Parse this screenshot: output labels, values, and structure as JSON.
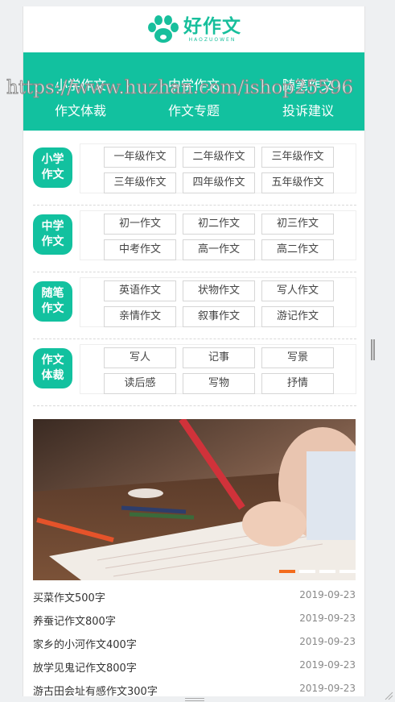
{
  "logo": {
    "title": "好作文",
    "subtitle": "HAOZUOWEN",
    "brand_color": "#17bf9c"
  },
  "nav": [
    "小学作文",
    "中学作文",
    "随笔作文",
    "作文体裁",
    "作文专题",
    "投诉建议"
  ],
  "watermark": "https://www.huzhan.com/ishop25596",
  "categories": [
    {
      "label": "小学作文",
      "items": [
        "一年级作文",
        "二年级作文",
        "三年级作文",
        "三年级作文",
        "四年级作文",
        "五年级作文"
      ]
    },
    {
      "label": "中学作文",
      "items": [
        "初一作文",
        "初二作文",
        "初三作文",
        "中考作文",
        "高一作文",
        "高二作文"
      ]
    },
    {
      "label": "随笔作文",
      "items": [
        "英语作文",
        "状物作文",
        "写人作文",
        "亲情作文",
        "叙事作文",
        "游记作文"
      ]
    },
    {
      "label": "作文体裁",
      "items": [
        "写人",
        "记事",
        "写景",
        "读后感",
        "写物",
        "抒情"
      ]
    }
  ],
  "banner": {
    "image": "child-writing-photo",
    "slides": 4,
    "active_slide": 1,
    "active_color": "#f36b1c"
  },
  "articles": [
    {
      "title": "买菜作文500字",
      "date": "2019-09-23"
    },
    {
      "title": "养蚕记作文800字",
      "date": "2019-09-23"
    },
    {
      "title": "家乡的小河作文400字",
      "date": "2019-09-23"
    },
    {
      "title": "放学见鬼记作文800字",
      "date": "2019-09-23"
    },
    {
      "title": "游古田会址有感作文300字",
      "date": "2019-09-23"
    }
  ],
  "accent_color": "#12c19f"
}
